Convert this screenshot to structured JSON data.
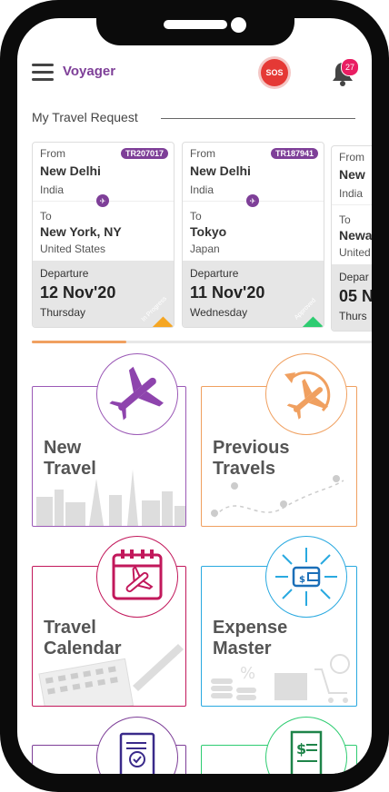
{
  "app": {
    "title": "Voyager"
  },
  "header": {
    "sos_label": "SOS",
    "notification_count": "27"
  },
  "section": {
    "title": "My Travel Request"
  },
  "labels": {
    "from": "From",
    "to": "To",
    "departure": "Departure"
  },
  "cards": [
    {
      "id": "TR207017",
      "from_city": "New Delhi",
      "from_country": "India",
      "to_city": "New York, NY",
      "to_country": "United States",
      "dep_date": "12 Nov'20",
      "dep_day": "Thursday",
      "status": "In Progress",
      "status_color": "#f5a623"
    },
    {
      "id": "TR187941",
      "from_city": "New Delhi",
      "from_country": "India",
      "to_city": "Tokyo",
      "to_country": "Japan",
      "dep_date": "11 Nov'20",
      "dep_day": "Wednesday",
      "status": "Approved",
      "status_color": "#2ecc71"
    },
    {
      "from_city": "New",
      "from_country": "India",
      "to_city": "Newa",
      "to_country": "United",
      "dep_label_partial": "Depar",
      "dep_date": "05 N",
      "dep_day": "Thurs"
    }
  ],
  "tiles": [
    {
      "label": "New\nTravel",
      "color": "#9b59b6",
      "icon": "airplane-icon"
    },
    {
      "label": "Previous\nTravels",
      "color": "#f0a060",
      "icon": "history-airplane-icon"
    },
    {
      "label": "Travel\nCalendar",
      "color": "#c2185b",
      "icon": "calendar-airplane-icon"
    },
    {
      "label": "Expense\nMaster",
      "color": "#29a9e0",
      "icon": "wallet-arrows-icon"
    },
    {
      "icon": "document-check-icon",
      "color": "#7e3f98"
    },
    {
      "icon": "receipt-dollar-icon",
      "color": "#2ecc71"
    }
  ]
}
